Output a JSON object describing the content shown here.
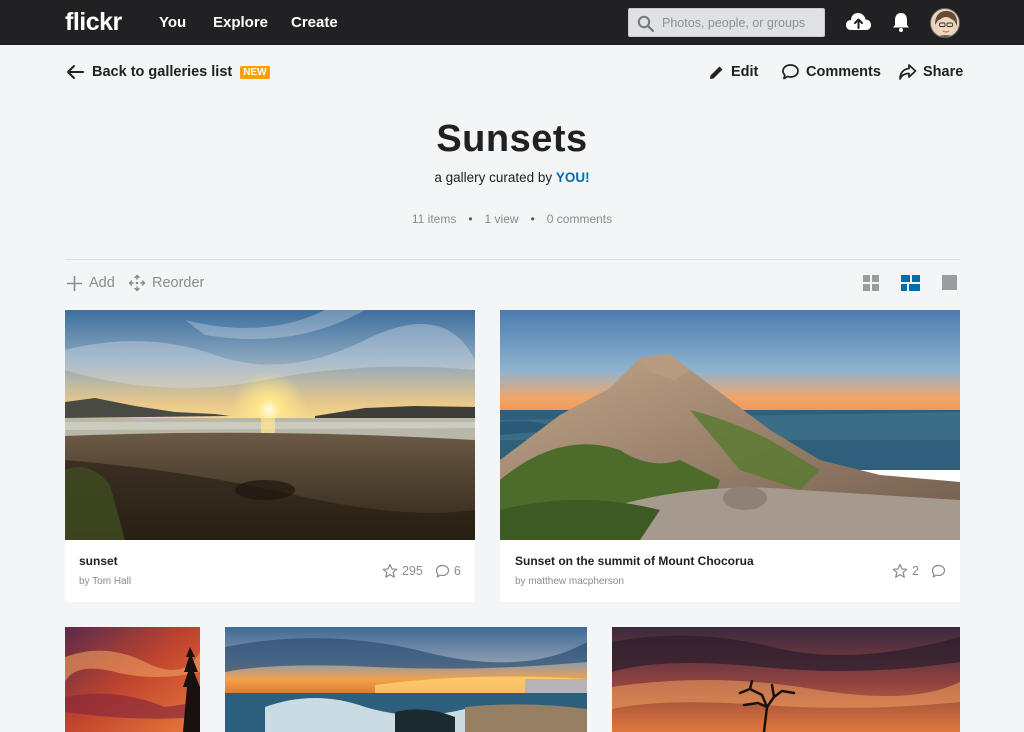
{
  "nav": {
    "logo": "flickr",
    "links": [
      "You",
      "Explore",
      "Create"
    ],
    "search_placeholder": "Photos, people, or groups"
  },
  "subbar": {
    "back_label": "Back to galleries list",
    "badge": "NEW",
    "edit": "Edit",
    "comments": "Comments",
    "share": "Share"
  },
  "gallery": {
    "title": "Sunsets",
    "subtitle_prefix": "a gallery curated by",
    "curator": "YOU!",
    "items": "11 items",
    "views": "1 view",
    "comments": "0 comments"
  },
  "toolbar": {
    "add": "Add",
    "reorder": "Reorder",
    "active_view": "justified"
  },
  "photos": [
    {
      "title": "sunset",
      "author": "by Tom Hall",
      "faves": "295",
      "comments": "6"
    },
    {
      "title": "Sunset on the summit of Mount Chocorua",
      "author": "by matthew macpherson",
      "faves": "2",
      "comments": ""
    }
  ],
  "colors": {
    "accent_blue": "#006dac",
    "new_badge": "#ff9f00",
    "topbar": "#212124"
  }
}
